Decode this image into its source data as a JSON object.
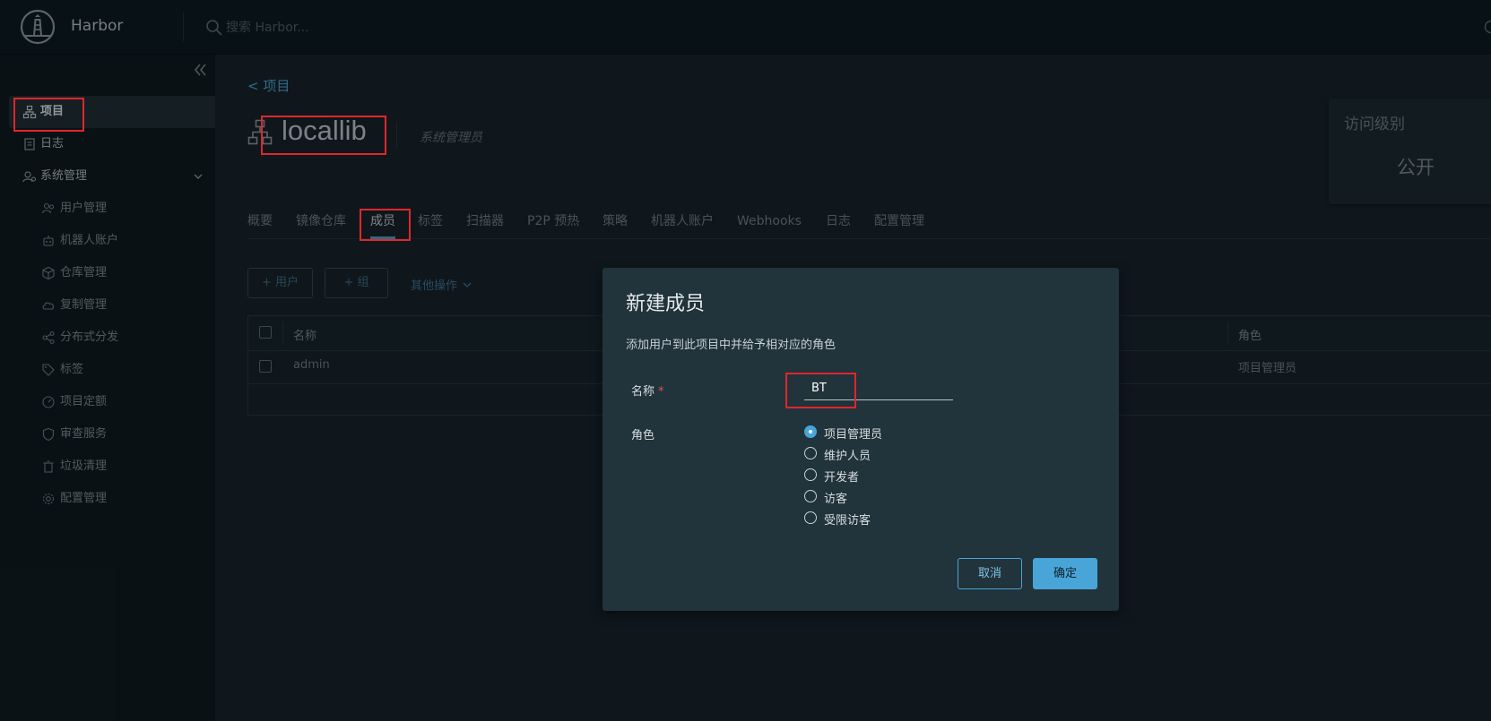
{
  "header": {
    "app_name": "Harbor",
    "search_placeholder": "搜索 Harbor..."
  },
  "sidebar": {
    "items": [
      {
        "label": "项目",
        "icon": "project-icon",
        "active": true
      },
      {
        "label": "日志",
        "icon": "log-icon"
      },
      {
        "label": "系统管理",
        "icon": "admin-icon",
        "expanded": true
      }
    ],
    "sub_items": [
      {
        "label": "用户管理",
        "icon": "users-icon"
      },
      {
        "label": "机器人账户",
        "icon": "robot-icon"
      },
      {
        "label": "仓库管理",
        "icon": "registry-icon"
      },
      {
        "label": "复制管理",
        "icon": "cloud-icon"
      },
      {
        "label": "分布式分发",
        "icon": "share-icon"
      },
      {
        "label": "标签",
        "icon": "tag-icon"
      },
      {
        "label": "项目定额",
        "icon": "quota-icon"
      },
      {
        "label": "审查服务",
        "icon": "shield-icon"
      },
      {
        "label": "垃圾清理",
        "icon": "trash-icon"
      },
      {
        "label": "配置管理",
        "icon": "gear-icon"
      }
    ]
  },
  "main": {
    "back_link": "<  项目",
    "project_name": "locallib",
    "role": "系统管理员",
    "access_card": {
      "label": "访问级别",
      "value": "公开"
    },
    "tabs": [
      {
        "label": "概要"
      },
      {
        "label": "镜像仓库"
      },
      {
        "label": "成员",
        "active": true
      },
      {
        "label": "标签"
      },
      {
        "label": "扫描器"
      },
      {
        "label": "P2P 预热"
      },
      {
        "label": "策略"
      },
      {
        "label": "机器人账户"
      },
      {
        "label": "Webhooks"
      },
      {
        "label": "日志"
      },
      {
        "label": "配置管理"
      }
    ],
    "toolbar": {
      "add_user": "+ 用户",
      "add_group": "+ 组",
      "more_actions": "其他操作"
    },
    "grid": {
      "columns": [
        "名称",
        "角色"
      ],
      "rows": [
        {
          "name": "admin",
          "role": "项目管理员"
        }
      ]
    }
  },
  "modal": {
    "title": "新建成员",
    "description": "添加用户到此项目中并给予相对应的角色",
    "name_label": "名称",
    "required_mark": "*",
    "name_value": "BT",
    "role_label": "角色",
    "roles": [
      {
        "label": "项目管理员",
        "checked": true
      },
      {
        "label": "维护人员"
      },
      {
        "label": "开发者"
      },
      {
        "label": "访客"
      },
      {
        "label": "受限访客"
      }
    ],
    "cancel_label": "取消",
    "ok_label": "确定"
  }
}
